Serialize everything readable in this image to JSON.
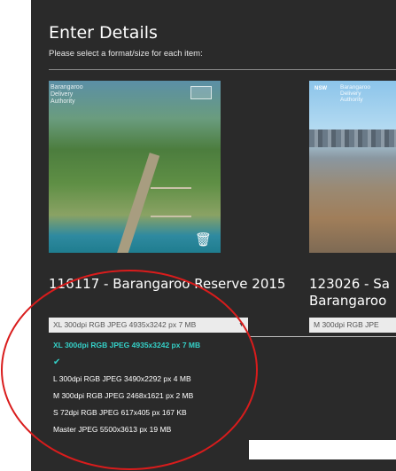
{
  "page": {
    "title": "Enter Details",
    "subtitle": "Please select a format/size for each item:"
  },
  "items": [
    {
      "title": "116117 - Barangaroo Reserve 2015",
      "thumbnail_text": [
        "Barangaroo",
        "Delivery",
        "Authority"
      ],
      "selected_format": "XL 300dpi RGB JPEG 4935x3242 px 7 MB",
      "options": [
        "XL 300dpi RGB JPEG 4935x3242 px 7 MB",
        "L 300dpi RGB JPEG 3490x2292 px 4 MB",
        "M 300dpi RGB JPEG 2468x1621 px 2 MB",
        "S 72dpi RGB JPEG 617x405 px 167 KB",
        "Master JPEG 5500x3613 px 19 MB"
      ]
    },
    {
      "title_line1": "123026 - Sa",
      "title_line2": "Barangaroo",
      "thumbnail_text": [
        "Barangaroo",
        "Delivery",
        "Authority"
      ],
      "nsw_logo": "NSW",
      "selected_format": "M 300dpi RGB JPE"
    }
  ],
  "icons": {
    "trash": "trash-icon",
    "check": "check-icon",
    "caret": "caret-down-icon"
  },
  "colors": {
    "background": "#2a2a2a",
    "accent": "#34d1c8",
    "annotation": "#d91c1c"
  }
}
